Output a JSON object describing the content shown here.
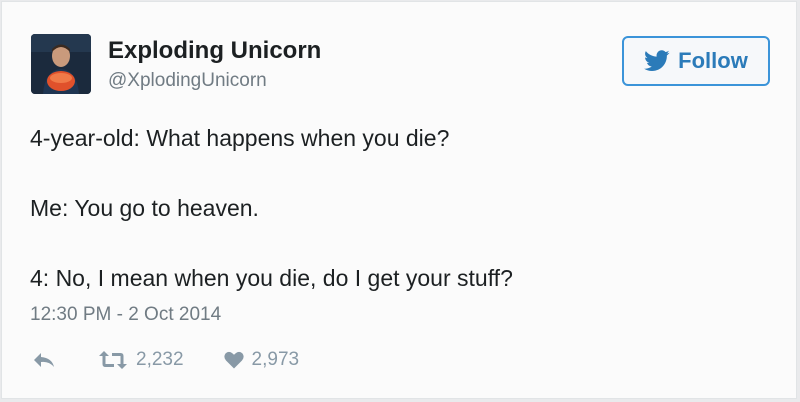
{
  "author": {
    "display_name": "Exploding Unicorn",
    "handle": "@XplodingUnicorn"
  },
  "follow_button": {
    "label": "Follow",
    "icon": "twitter-bird-icon"
  },
  "tweet": {
    "lines": [
      "4-year-old: What happens when you die?",
      "Me: You go to heaven.",
      "4: No, I mean when you die, do I get your stuff?"
    ],
    "timestamp": "12:30 PM - 2 Oct 2014"
  },
  "actions": {
    "reply": {
      "icon": "reply-icon"
    },
    "retweet": {
      "icon": "retweet-icon",
      "count": "2,232"
    },
    "like": {
      "icon": "heart-icon",
      "count": "2,973"
    }
  },
  "colors": {
    "accent": "#3b94d9",
    "muted": "#8899a6",
    "text": "#1c2022"
  }
}
